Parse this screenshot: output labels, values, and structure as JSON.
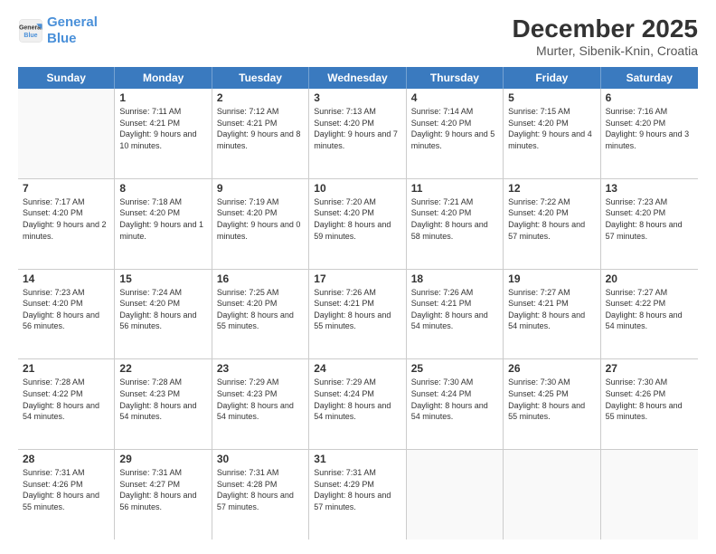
{
  "header": {
    "logo_line1": "General",
    "logo_line2": "Blue",
    "title": "December 2025",
    "subtitle": "Murter, Sibenik-Knin, Croatia"
  },
  "calendar": {
    "days_of_week": [
      "Sunday",
      "Monday",
      "Tuesday",
      "Wednesday",
      "Thursday",
      "Friday",
      "Saturday"
    ],
    "weeks": [
      [
        {
          "day": "",
          "sunrise": "",
          "sunset": "",
          "daylight": ""
        },
        {
          "day": "1",
          "sunrise": "Sunrise: 7:11 AM",
          "sunset": "Sunset: 4:21 PM",
          "daylight": "Daylight: 9 hours and 10 minutes."
        },
        {
          "day": "2",
          "sunrise": "Sunrise: 7:12 AM",
          "sunset": "Sunset: 4:21 PM",
          "daylight": "Daylight: 9 hours and 8 minutes."
        },
        {
          "day": "3",
          "sunrise": "Sunrise: 7:13 AM",
          "sunset": "Sunset: 4:20 PM",
          "daylight": "Daylight: 9 hours and 7 minutes."
        },
        {
          "day": "4",
          "sunrise": "Sunrise: 7:14 AM",
          "sunset": "Sunset: 4:20 PM",
          "daylight": "Daylight: 9 hours and 5 minutes."
        },
        {
          "day": "5",
          "sunrise": "Sunrise: 7:15 AM",
          "sunset": "Sunset: 4:20 PM",
          "daylight": "Daylight: 9 hours and 4 minutes."
        },
        {
          "day": "6",
          "sunrise": "Sunrise: 7:16 AM",
          "sunset": "Sunset: 4:20 PM",
          "daylight": "Daylight: 9 hours and 3 minutes."
        }
      ],
      [
        {
          "day": "7",
          "sunrise": "Sunrise: 7:17 AM",
          "sunset": "Sunset: 4:20 PM",
          "daylight": "Daylight: 9 hours and 2 minutes."
        },
        {
          "day": "8",
          "sunrise": "Sunrise: 7:18 AM",
          "sunset": "Sunset: 4:20 PM",
          "daylight": "Daylight: 9 hours and 1 minute."
        },
        {
          "day": "9",
          "sunrise": "Sunrise: 7:19 AM",
          "sunset": "Sunset: 4:20 PM",
          "daylight": "Daylight: 9 hours and 0 minutes."
        },
        {
          "day": "10",
          "sunrise": "Sunrise: 7:20 AM",
          "sunset": "Sunset: 4:20 PM",
          "daylight": "Daylight: 8 hours and 59 minutes."
        },
        {
          "day": "11",
          "sunrise": "Sunrise: 7:21 AM",
          "sunset": "Sunset: 4:20 PM",
          "daylight": "Daylight: 8 hours and 58 minutes."
        },
        {
          "day": "12",
          "sunrise": "Sunrise: 7:22 AM",
          "sunset": "Sunset: 4:20 PM",
          "daylight": "Daylight: 8 hours and 57 minutes."
        },
        {
          "day": "13",
          "sunrise": "Sunrise: 7:23 AM",
          "sunset": "Sunset: 4:20 PM",
          "daylight": "Daylight: 8 hours and 57 minutes."
        }
      ],
      [
        {
          "day": "14",
          "sunrise": "Sunrise: 7:23 AM",
          "sunset": "Sunset: 4:20 PM",
          "daylight": "Daylight: 8 hours and 56 minutes."
        },
        {
          "day": "15",
          "sunrise": "Sunrise: 7:24 AM",
          "sunset": "Sunset: 4:20 PM",
          "daylight": "Daylight: 8 hours and 56 minutes."
        },
        {
          "day": "16",
          "sunrise": "Sunrise: 7:25 AM",
          "sunset": "Sunset: 4:20 PM",
          "daylight": "Daylight: 8 hours and 55 minutes."
        },
        {
          "day": "17",
          "sunrise": "Sunrise: 7:26 AM",
          "sunset": "Sunset: 4:21 PM",
          "daylight": "Daylight: 8 hours and 55 minutes."
        },
        {
          "day": "18",
          "sunrise": "Sunrise: 7:26 AM",
          "sunset": "Sunset: 4:21 PM",
          "daylight": "Daylight: 8 hours and 54 minutes."
        },
        {
          "day": "19",
          "sunrise": "Sunrise: 7:27 AM",
          "sunset": "Sunset: 4:21 PM",
          "daylight": "Daylight: 8 hours and 54 minutes."
        },
        {
          "day": "20",
          "sunrise": "Sunrise: 7:27 AM",
          "sunset": "Sunset: 4:22 PM",
          "daylight": "Daylight: 8 hours and 54 minutes."
        }
      ],
      [
        {
          "day": "21",
          "sunrise": "Sunrise: 7:28 AM",
          "sunset": "Sunset: 4:22 PM",
          "daylight": "Daylight: 8 hours and 54 minutes."
        },
        {
          "day": "22",
          "sunrise": "Sunrise: 7:28 AM",
          "sunset": "Sunset: 4:23 PM",
          "daylight": "Daylight: 8 hours and 54 minutes."
        },
        {
          "day": "23",
          "sunrise": "Sunrise: 7:29 AM",
          "sunset": "Sunset: 4:23 PM",
          "daylight": "Daylight: 8 hours and 54 minutes."
        },
        {
          "day": "24",
          "sunrise": "Sunrise: 7:29 AM",
          "sunset": "Sunset: 4:24 PM",
          "daylight": "Daylight: 8 hours and 54 minutes."
        },
        {
          "day": "25",
          "sunrise": "Sunrise: 7:30 AM",
          "sunset": "Sunset: 4:24 PM",
          "daylight": "Daylight: 8 hours and 54 minutes."
        },
        {
          "day": "26",
          "sunrise": "Sunrise: 7:30 AM",
          "sunset": "Sunset: 4:25 PM",
          "daylight": "Daylight: 8 hours and 55 minutes."
        },
        {
          "day": "27",
          "sunrise": "Sunrise: 7:30 AM",
          "sunset": "Sunset: 4:26 PM",
          "daylight": "Daylight: 8 hours and 55 minutes."
        }
      ],
      [
        {
          "day": "28",
          "sunrise": "Sunrise: 7:31 AM",
          "sunset": "Sunset: 4:26 PM",
          "daylight": "Daylight: 8 hours and 55 minutes."
        },
        {
          "day": "29",
          "sunrise": "Sunrise: 7:31 AM",
          "sunset": "Sunset: 4:27 PM",
          "daylight": "Daylight: 8 hours and 56 minutes."
        },
        {
          "day": "30",
          "sunrise": "Sunrise: 7:31 AM",
          "sunset": "Sunset: 4:28 PM",
          "daylight": "Daylight: 8 hours and 57 minutes."
        },
        {
          "day": "31",
          "sunrise": "Sunrise: 7:31 AM",
          "sunset": "Sunset: 4:29 PM",
          "daylight": "Daylight: 8 hours and 57 minutes."
        },
        {
          "day": "",
          "sunrise": "",
          "sunset": "",
          "daylight": ""
        },
        {
          "day": "",
          "sunrise": "",
          "sunset": "",
          "daylight": ""
        },
        {
          "day": "",
          "sunrise": "",
          "sunset": "",
          "daylight": ""
        }
      ]
    ]
  }
}
